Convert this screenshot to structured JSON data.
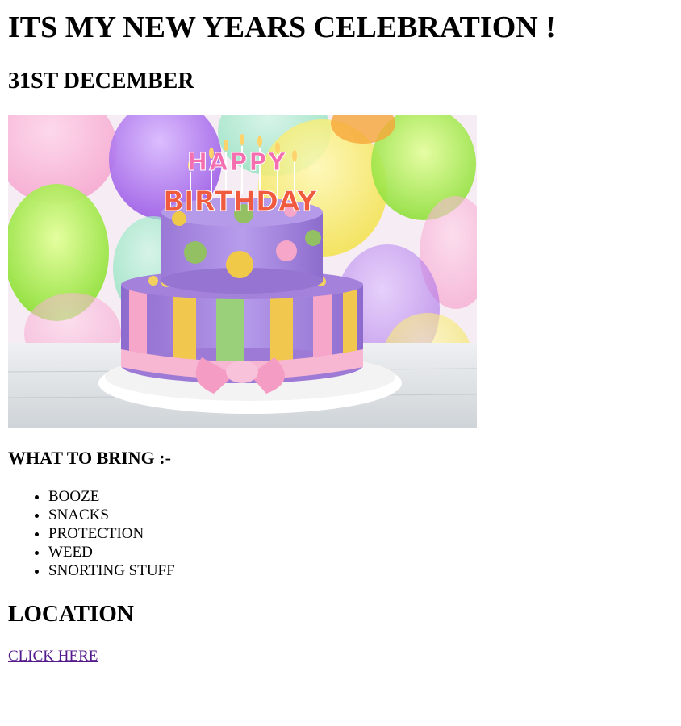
{
  "page": {
    "title": "ITS MY NEW YEARS CELEBRATION !",
    "date": "31ST DECEMBER"
  },
  "photo": {
    "cake_text_top": "HAPPY",
    "cake_text_bottom": "BIRTHDAY",
    "icon": "birthday-cake-image"
  },
  "bring": {
    "heading": "WHAT TO BRING :-",
    "items": [
      "BOOZE",
      "SNACKS",
      "PROTECTION",
      "WEED",
      "SNORTING STUFF"
    ]
  },
  "location": {
    "heading": "LOCATION",
    "link_label": "CLICK HERE"
  },
  "colors": {
    "link_visited": "#551a8b",
    "text": "#000000",
    "background": "#ffffff"
  }
}
